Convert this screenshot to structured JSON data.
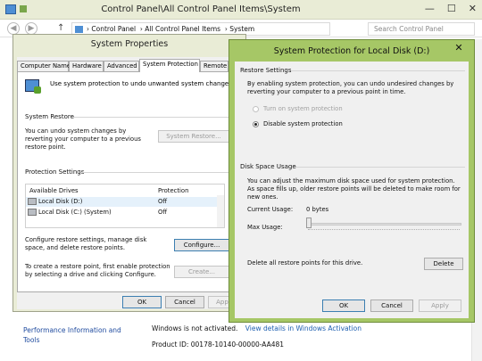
{
  "control_panel": {
    "title": "Control Panel\\All Control Panel Items\\System",
    "window_controls": {
      "minimize": "—",
      "maximize": "☐",
      "close": "✕"
    },
    "breadcrumb": [
      "Control Panel",
      "All Control Panel Items",
      "System"
    ],
    "search_placeholder": "Search Control Panel",
    "footer_link": "Performance Information and Tools",
    "activation_text": "Windows is not activated.",
    "activation_link": "View details in Windows Activation",
    "product_id": "Product ID:  00178-10140-00000-AA481"
  },
  "system_properties": {
    "title": "System Properties",
    "tabs": [
      "Computer Name",
      "Hardware",
      "Advanced",
      "System Protection",
      "Remote"
    ],
    "active_tab": "System Protection",
    "intro": "Use system protection to undo unwanted system changes.",
    "system_restore": {
      "group_label": "System Restore",
      "description": "You can undo system changes by reverting your computer to a previous restore point.",
      "button": "System Restore..."
    },
    "protection_settings": {
      "group_label": "Protection Settings",
      "columns": [
        "Available Drives",
        "Protection"
      ],
      "rows": [
        {
          "drive": "Local Disk (D:)",
          "protection": "Off"
        },
        {
          "drive": "Local Disk (C:) (System)",
          "protection": "Off"
        }
      ],
      "configure_text": "Configure restore settings, manage disk space, and delete restore points.",
      "configure_button": "Configure...",
      "create_text": "To create a restore point, first enable protection by selecting a drive and clicking Configure.",
      "create_button": "Create..."
    },
    "buttons": {
      "ok": "OK",
      "cancel": "Cancel",
      "apply": "Apply"
    }
  },
  "protection_dialog": {
    "title": "System Protection for Local Disk (D:)",
    "close": "✕",
    "restore_settings": {
      "group_label": "Restore Settings",
      "description": "By enabling system protection, you can undo undesired changes by reverting your computer to a previous point in time.",
      "option_on": "Turn on system protection",
      "option_off": "Disable system protection",
      "selected": "Disable system protection"
    },
    "disk_space": {
      "group_label": "Disk Space Usage",
      "description": "You can adjust the maximum disk space used for system protection. As space fills up, older restore points will be deleted to make room for new ones.",
      "current_usage_label": "Current Usage:",
      "current_usage_value": "0 bytes",
      "max_usage_label": "Max Usage:",
      "max_usage_level": 0,
      "delete_text": "Delete all restore points for this drive.",
      "delete_button": "Delete"
    },
    "buttons": {
      "ok": "OK",
      "cancel": "Cancel",
      "apply": "Apply"
    }
  },
  "colors": {
    "titlebar": "#e9ecd6",
    "dialog_frame": "#a6c766",
    "link": "#1e5fb0"
  }
}
